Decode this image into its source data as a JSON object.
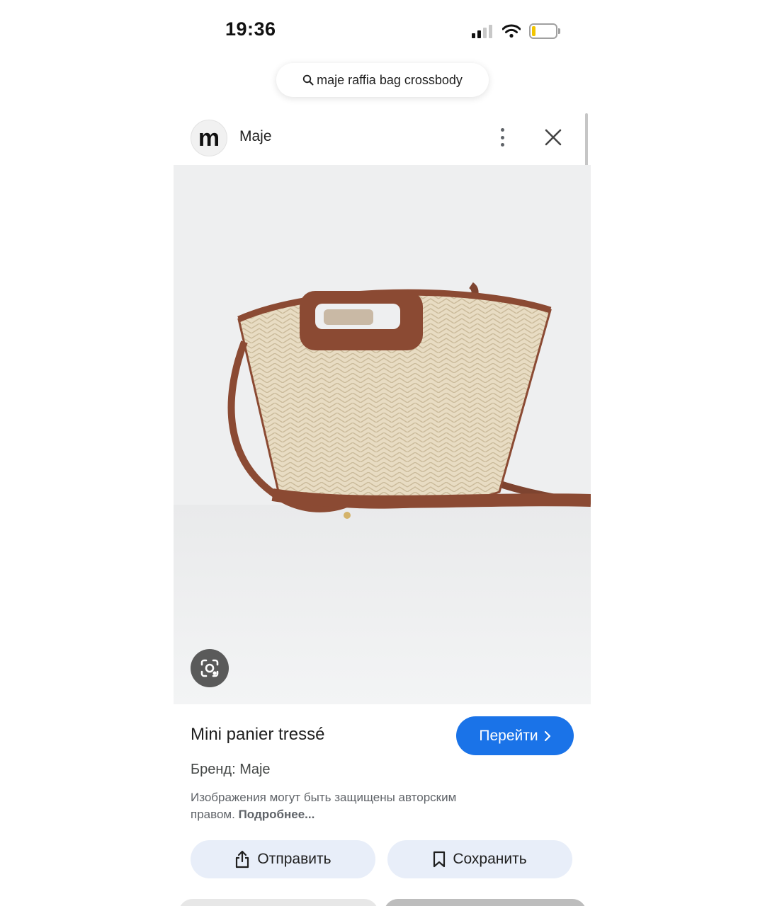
{
  "status_bar": {
    "time": "19:36",
    "icons": [
      "cellular-signal-icon",
      "wifi-icon",
      "battery-low-icon"
    ],
    "battery_color": "#f2c500"
  },
  "search": {
    "query": "maje raffia bag crossbody",
    "icon": "search-icon"
  },
  "source": {
    "logo_letter": "m",
    "name": "Maje",
    "icons": [
      "more-vert-icon",
      "close-icon"
    ]
  },
  "image": {
    "subject": "straw raffia basket bag with brown leather handle and crossbody strap",
    "lens_icon": "google-lens-icon"
  },
  "product": {
    "title": "Mini panier tressé",
    "go_label": "Перейти",
    "brand_line": "Бренд: Maje",
    "copyright_text": "Изображения могут быть защищены авторским правом.",
    "more_link": "Подробнее..."
  },
  "actions": {
    "share_label": "Отправить",
    "save_label": "Сохранить"
  },
  "colors": {
    "accent": "#1a73e8",
    "action_button_bg": "#e8eef9",
    "image_bg": "#eeeff0",
    "bag_leather": "#8b4a33",
    "bag_straw": "#e6d9bf"
  }
}
